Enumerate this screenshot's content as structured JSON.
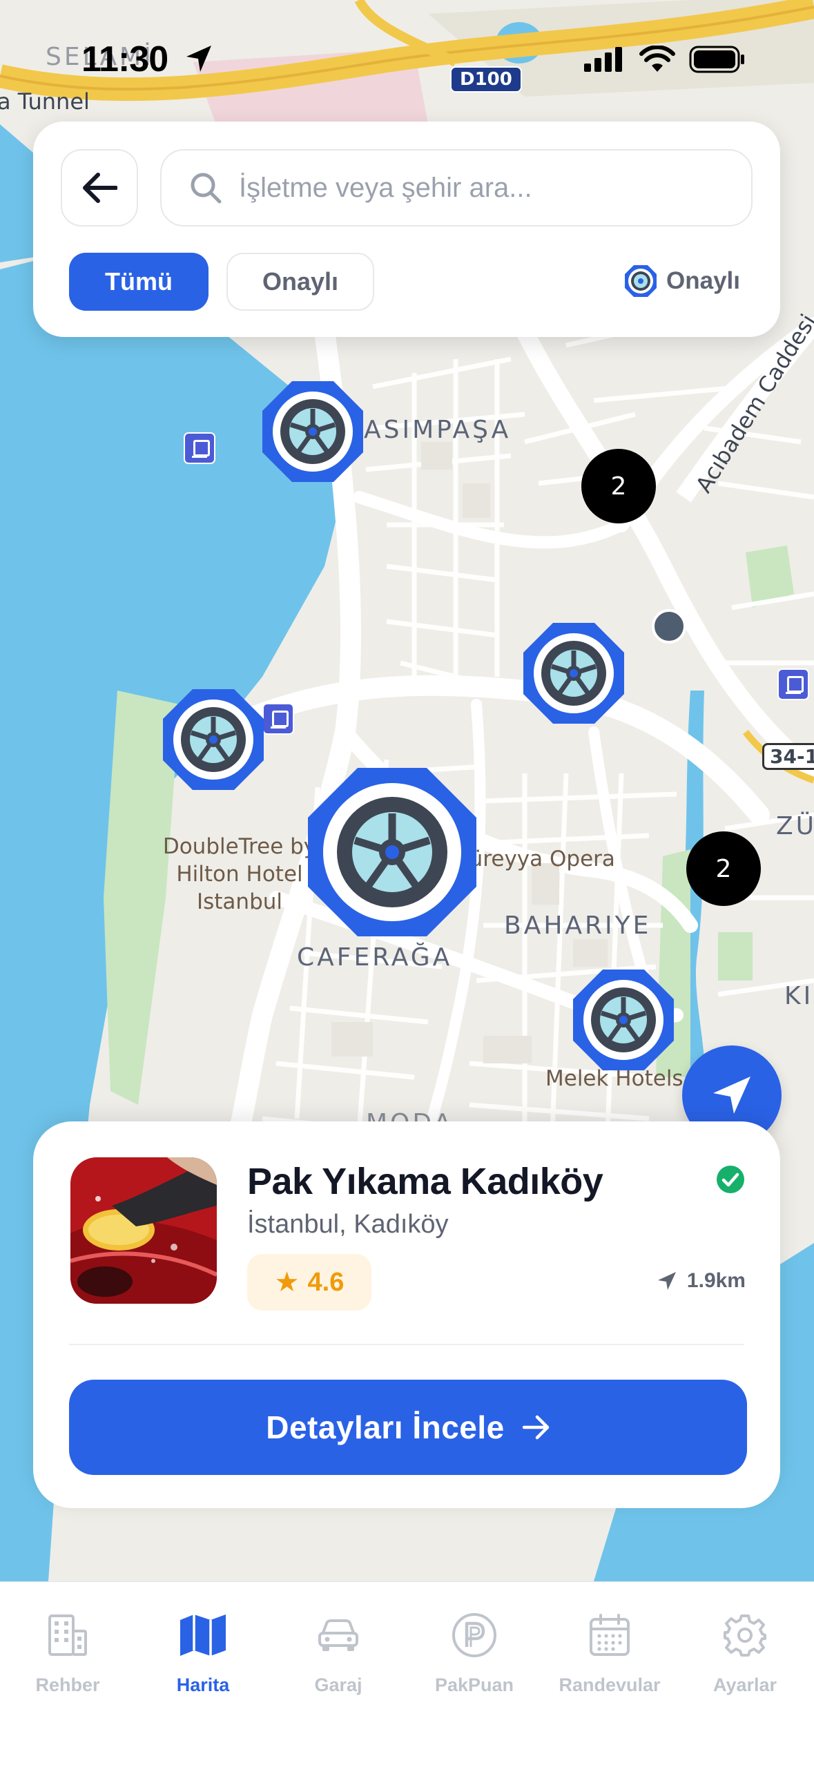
{
  "status_bar": {
    "time": "11:30"
  },
  "map": {
    "district_labels": [
      "KASIMPAŞA",
      "BAHARIYE",
      "CAFERAĞA",
      "MODA",
      "ZÜ",
      "KI",
      "SELAMİ"
    ],
    "road_labels": [
      "Acıbadem Caddesi",
      "D100",
      "34-1",
      "a Tunnel"
    ],
    "poi_labels": [
      "DoubleTree by Hilton Hotel Istanbul",
      "Süreyya Opera",
      "Melek Hotels"
    ],
    "clusters": [
      {
        "count": "2"
      },
      {
        "count": "2"
      }
    ]
  },
  "search": {
    "placeholder": "İşletme veya şehir ara...",
    "value": "",
    "filters": [
      {
        "label": "Tümü",
        "active": true
      },
      {
        "label": "Onaylı",
        "active": false
      }
    ],
    "legend_label": "Onaylı"
  },
  "card": {
    "name": "Pak Yıkama Kadıköy",
    "location": "İstanbul, Kadıköy",
    "rating": "4.6",
    "distance": "1.9km",
    "verified": true,
    "button_label": "Detayları İncele"
  },
  "tabs": [
    {
      "label": "Rehber",
      "icon": "building-icon",
      "active": false
    },
    {
      "label": "Harita",
      "icon": "map-icon",
      "active": true
    },
    {
      "label": "Garaj",
      "icon": "car-icon",
      "active": false
    },
    {
      "label": "PakPuan",
      "icon": "points-icon",
      "active": false
    },
    {
      "label": "Randevular",
      "icon": "calendar-icon",
      "active": false
    },
    {
      "label": "Ayarlar",
      "icon": "gear-icon",
      "active": false
    }
  ],
  "colors": {
    "accent": "#2a62e6",
    "water": "#6fc3ea",
    "rating": "#f09b0b",
    "verified": "#16b06b"
  }
}
